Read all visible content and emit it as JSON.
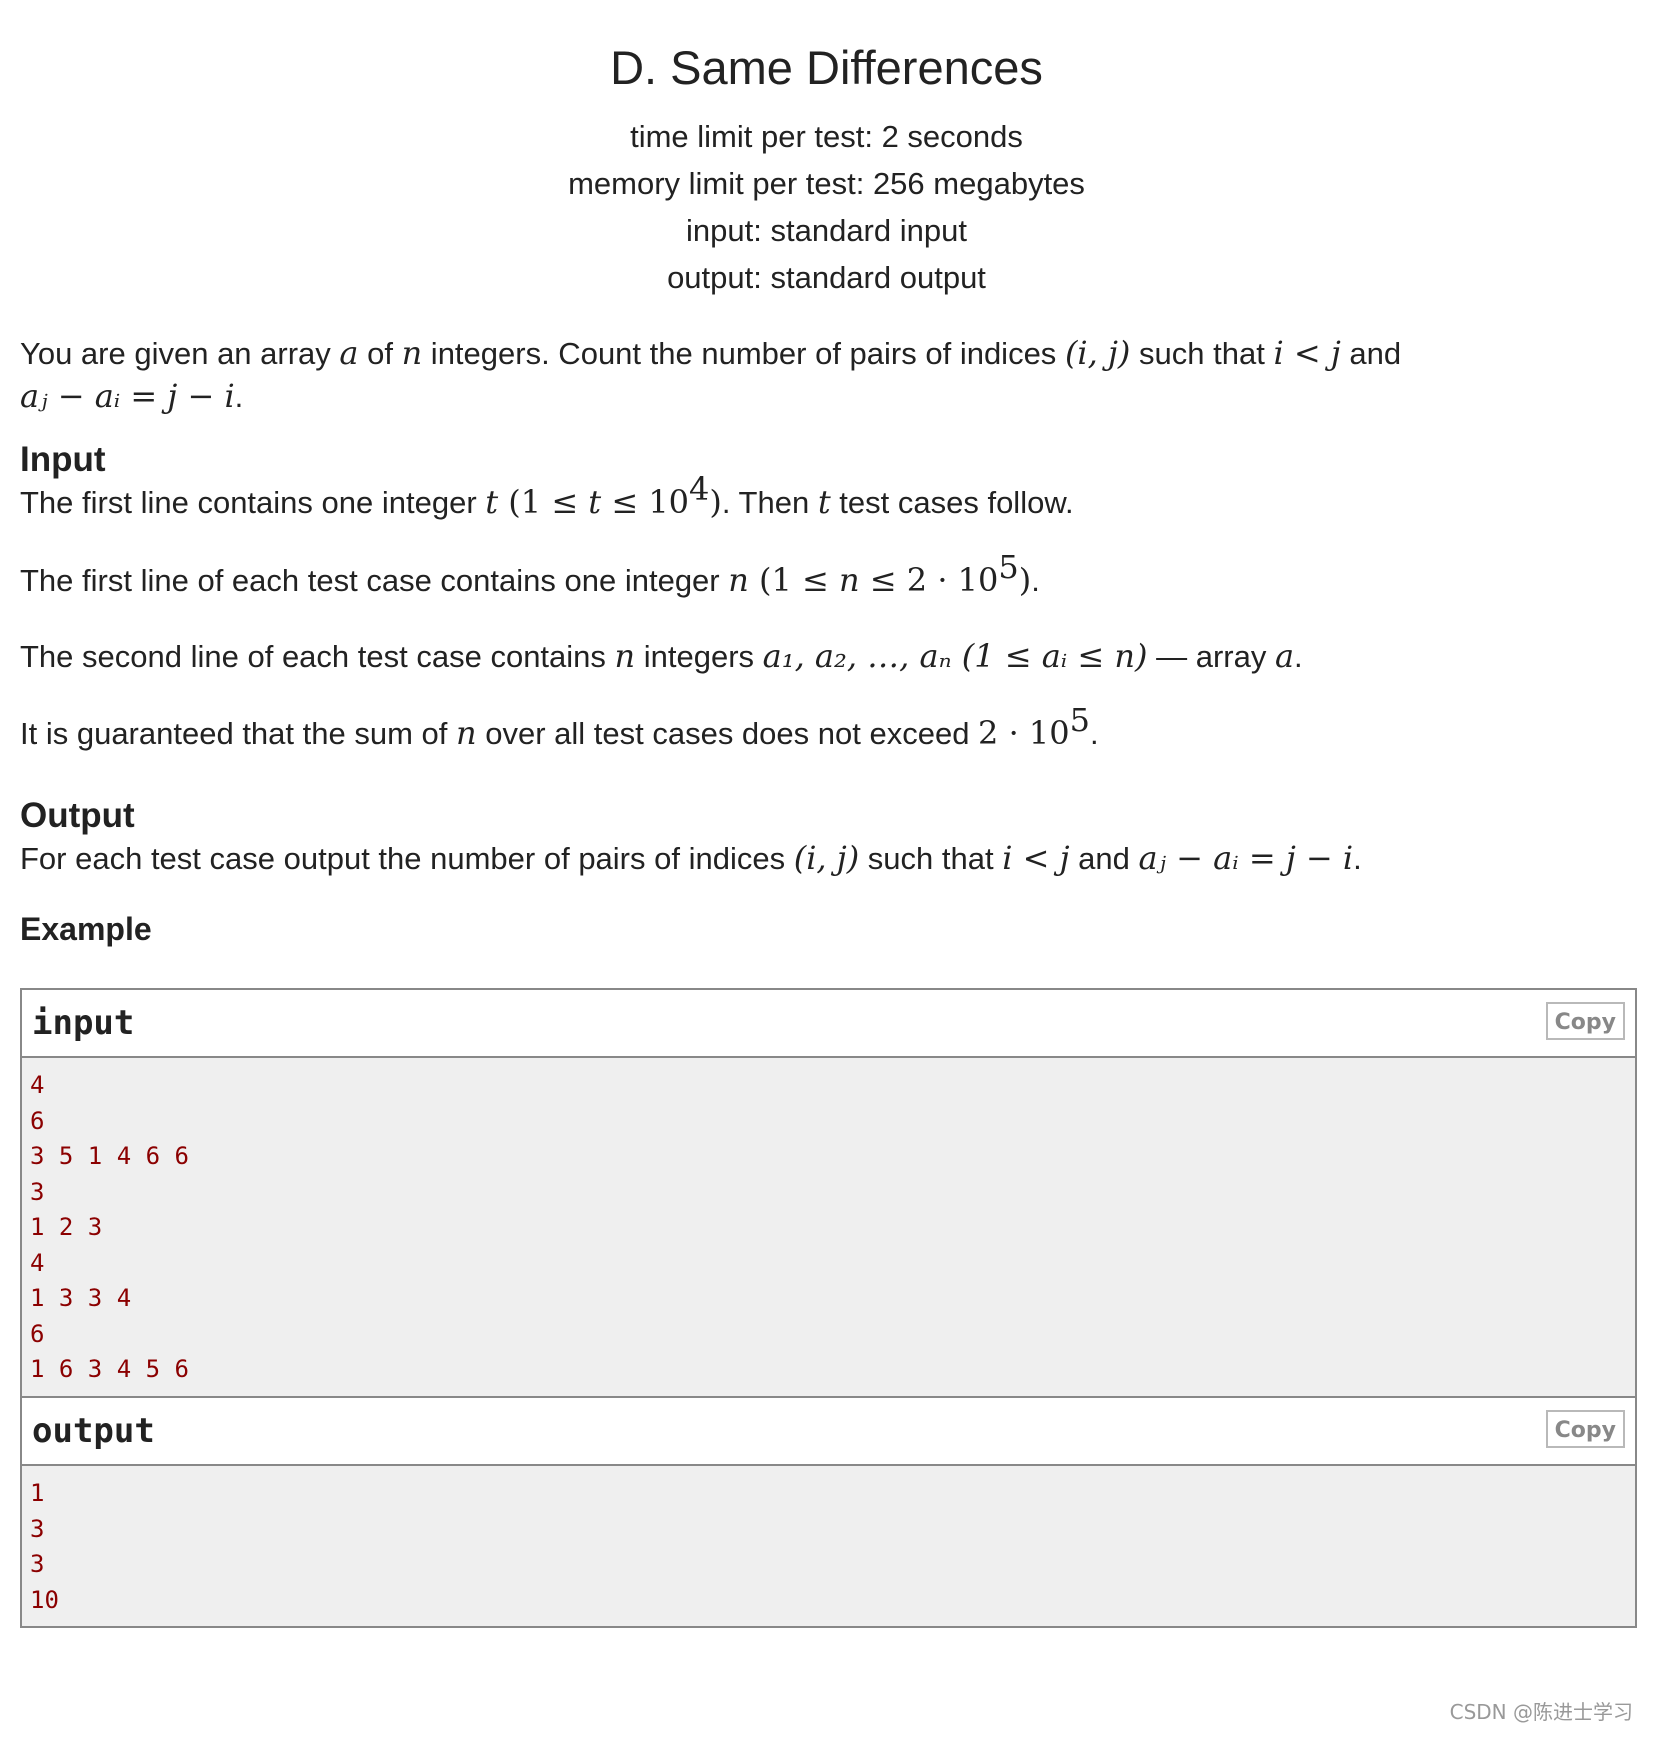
{
  "problem": {
    "title": "D. Same Differences",
    "time_limit": "time limit per test: 2 seconds",
    "memory_limit": "memory limit per test: 256 megabytes",
    "input_file": "input: standard input",
    "output_file": "output: standard output"
  },
  "statement": {
    "p1_a": "You are given an array ",
    "p1_var_a": "a",
    "p1_b": " of ",
    "p1_var_n": "n",
    "p1_c": " integers. Count the number of pairs of indices ",
    "p1_pair": "(i, j)",
    "p1_d": " such that ",
    "p1_cond": "i < j",
    "p1_e": " and",
    "p1_eq": "aⱼ − aᵢ = j − i",
    "p1_end": "."
  },
  "input_section": {
    "heading": "Input",
    "l1_a": "The first line contains one integer ",
    "l1_var": "t",
    "l1_range_open": " (1 ≤ ",
    "l1_range_var": "t",
    "l1_range_mid": " ≤ 10",
    "l1_range_exp": "4",
    "l1_range_close": ")",
    "l1_b": ". Then ",
    "l1_var2": "t",
    "l1_c": " test cases follow.",
    "l2_a": "The first line of each test case contains one integer ",
    "l2_var": "n",
    "l2_range_open": " (1 ≤ ",
    "l2_range_var": "n",
    "l2_range_mid": " ≤ 2 · 10",
    "l2_range_exp": "5",
    "l2_range_close": ")",
    "l2_end": ".",
    "l3_a": "The second line of each test case contains ",
    "l3_var": "n",
    "l3_b": " integers ",
    "l3_list": "a₁, a₂, …, aₙ",
    "l3_range": " (1 ≤ aᵢ ≤ n)",
    "l3_c": " — array ",
    "l3_var2": "a",
    "l3_end": ".",
    "l4_a": "It is guaranteed that the sum of ",
    "l4_var": "n",
    "l4_b": " over all test cases does not exceed ",
    "l4_val": "2 · 10",
    "l4_exp": "5",
    "l4_end": "."
  },
  "output_section": {
    "heading": "Output",
    "l1_a": "For each test case output the number of pairs of indices ",
    "l1_pair": "(i, j)",
    "l1_b": " such that ",
    "l1_cond": "i < j",
    "l1_c": " and ",
    "l1_eq": "aⱼ − aᵢ = j − i",
    "l1_end": "."
  },
  "example": {
    "heading": "Example",
    "input": {
      "title": "input",
      "copy_label": "Copy",
      "lines": [
        "4",
        "6",
        "3 5 1 4 6 6",
        "3",
        "1 2 3",
        "4",
        "1 3 3 4",
        "6",
        "1 6 3 4 5 6"
      ]
    },
    "output": {
      "title": "output",
      "copy_label": "Copy",
      "lines": [
        "1",
        "3",
        "3",
        "10"
      ]
    }
  },
  "watermark": "CSDN @陈进士学习",
  "colors": {
    "text": "#222222",
    "sample_text": "#8b0000",
    "sample_bg": "#efefef",
    "border": "#888888",
    "copy_text": "#888888"
  }
}
